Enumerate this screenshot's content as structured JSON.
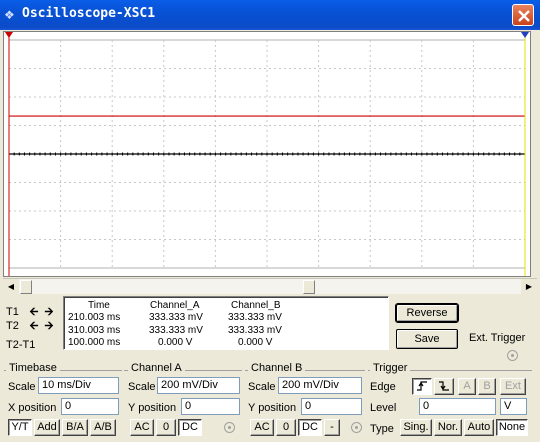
{
  "window": {
    "title": "Oscilloscope-XSC1"
  },
  "cursors": {
    "t1_label": "T1",
    "t2_label": "T2",
    "t2t1_label": "T2-T1",
    "headers": [
      "Time",
      "Channel_A",
      "Channel_B"
    ],
    "rows": [
      [
        "210.003 ms",
        "333.333 mV",
        "333.333 mV"
      ],
      [
        "310.003 ms",
        "333.333 mV",
        "333.333 mV"
      ],
      [
        "100.000 ms",
        "0.000 V",
        "0.000 V"
      ]
    ]
  },
  "buttons": {
    "reverse": "Reverse",
    "save": "Save",
    "ext_trigger": "Ext. Trigger"
  },
  "timebase": {
    "title": "Timebase",
    "scale_label": "Scale",
    "scale_value": "10 ms/Div",
    "xpos_label": "X position",
    "xpos_value": "0",
    "modes": [
      "Y/T",
      "Add",
      "B/A",
      "A/B"
    ]
  },
  "channel_a": {
    "title": "Channel A",
    "scale_label": "Scale",
    "scale_value": "200 mV/Div",
    "ypos_label": "Y position",
    "ypos_value": "0",
    "coupling": [
      "AC",
      "0",
      "DC"
    ]
  },
  "channel_b": {
    "title": "Channel B",
    "scale_label": "Scale",
    "scale_value": "200 mV/Div",
    "ypos_label": "Y position",
    "ypos_value": "0",
    "coupling": [
      "AC",
      "0",
      "DC",
      "-"
    ]
  },
  "trigger": {
    "title": "Trigger",
    "edge_label": "Edge",
    "edge_buttons": [
      "A",
      "B",
      "Ext"
    ],
    "level_label": "Level",
    "level_value": "0",
    "level_unit": "V",
    "type_label": "Type",
    "types": [
      "Sing.",
      "Nor.",
      "Auto",
      "None"
    ]
  },
  "chart_data": {
    "type": "line",
    "ylim": [
      -1,
      1
    ],
    "series": [
      {
        "color": "#cc0000",
        "values": [
          0.333,
          0.333
        ]
      },
      {
        "color": "#000000",
        "values": [
          0,
          0
        ]
      }
    ],
    "cursor_colors": {
      "t1": "#cc0000",
      "t2": "#2040c0"
    }
  }
}
